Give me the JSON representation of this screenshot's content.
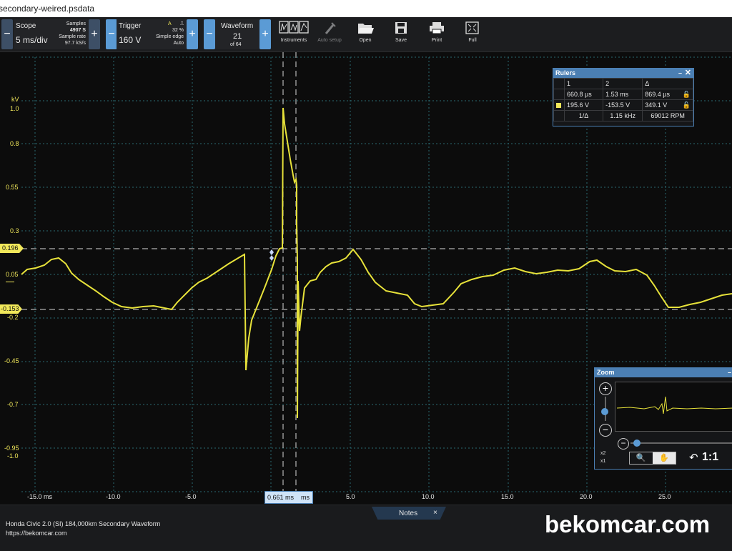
{
  "window": {
    "title": "secondary-weired.psdata"
  },
  "toolbar": {
    "scope": {
      "label": "Scope",
      "value": "5 ms/div",
      "samples_label": "Samples",
      "samples_value": "4907 S",
      "rate_label": "Sample rate",
      "rate_value": "97.7 kS/s"
    },
    "trigger": {
      "label": "Trigger",
      "value": "160 V",
      "channel": "A",
      "percent": "32 %",
      "mode": "Simple edge",
      "auto": "Auto"
    },
    "waveform": {
      "label": "Waveform",
      "index": "21",
      "of": "of 64"
    },
    "tools": [
      {
        "label": "Instruments",
        "icon": "instruments-icon"
      },
      {
        "label": "Auto setup",
        "icon": "auto-setup-icon"
      },
      {
        "label": "Open",
        "icon": "folder-open-icon"
      },
      {
        "label": "Save",
        "icon": "save-icon"
      },
      {
        "label": "Print",
        "icon": "print-icon"
      },
      {
        "label": "Full",
        "icon": "fullscreen-icon"
      }
    ],
    "minus": "−",
    "plus": "+"
  },
  "plot": {
    "y_unit": "kV",
    "y_ticks": [
      "1.0",
      "0.8",
      "0.55",
      "0.3",
      "0.05",
      "-0.2",
      "-0.45",
      "-0.7",
      "-0.95",
      "-1.0"
    ],
    "x_ticks": [
      "-15.0 ms",
      "-10.0",
      "-5.0",
      "5.0",
      "10.0",
      "15.0",
      "20.0",
      "25.0"
    ],
    "ruler_h1": "0.196",
    "ruler_h2": "-0.153",
    "ruler_v_label": "0.661 ms",
    "ruler_v_suffix": "ms",
    "trace_color": "#e7e23a",
    "tag_color": "#f1e85a"
  },
  "rulers_panel": {
    "title": "Rulers",
    "col1": "1",
    "col2": "2",
    "col3": "Δ",
    "row1": [
      "660.8 µs",
      "1.53 ms",
      "869.4 µs"
    ],
    "row2": [
      "195.6 V",
      "-153.5 V",
      "349.1 V"
    ],
    "row3": [
      "1/Δ",
      "1.15 kHz",
      "69012 RPM"
    ]
  },
  "zoom_panel": {
    "title": "Zoom",
    "x2": "x2",
    "x1": "x1",
    "ratio": "1:1"
  },
  "footer": {
    "line1": "Honda Civic 2.0 (SI) 184,000km Secondary  Waveform",
    "line2": "https://bekomcar.com",
    "notes": "Notes",
    "notes_close": "×"
  },
  "watermark": "bekomcar.com"
}
